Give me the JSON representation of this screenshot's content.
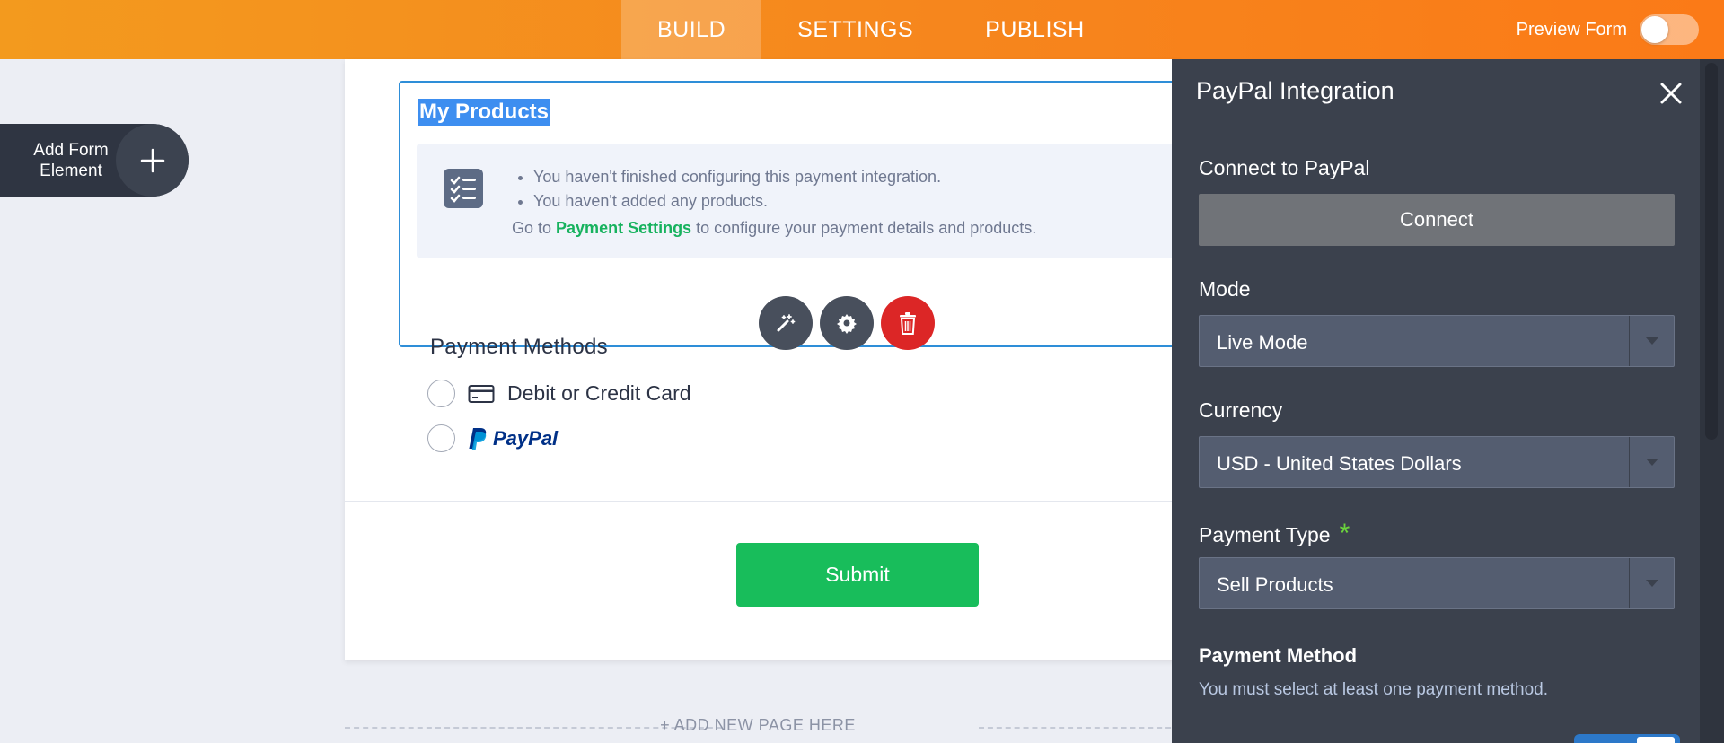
{
  "topbar": {
    "tabs": [
      {
        "label": "BUILD",
        "active": true
      },
      {
        "label": "SETTINGS",
        "active": false
      },
      {
        "label": "PUBLISH",
        "active": false
      }
    ],
    "preview_label": "Preview Form",
    "preview_on": false
  },
  "sidebar": {
    "add_element_line1": "Add Form",
    "add_element_line2": "Element",
    "add_icon": "plus-icon"
  },
  "form": {
    "products_title": "My Products",
    "notice": {
      "items": [
        "You haven't finished configuring this payment integration.",
        "You haven't added any products."
      ],
      "goto_prefix": "Go to ",
      "goto_link": "Payment Settings",
      "goto_suffix": " to configure your payment details and products."
    },
    "tools": [
      "wand-icon",
      "gear-icon",
      "trash-icon"
    ],
    "payment_methods": {
      "title": "Payment Methods",
      "options": [
        {
          "label": "Debit or Credit Card",
          "icon": "credit-card-icon"
        },
        {
          "label": "PayPal",
          "icon": "paypal-logo"
        }
      ]
    },
    "submit_label": "Submit",
    "add_page_label": "+ ADD NEW PAGE HERE"
  },
  "panel": {
    "title": "PayPal Integration",
    "connect_label": "Connect to PayPal",
    "connect_button": "Connect",
    "mode_label": "Mode",
    "mode_value": "Live Mode",
    "currency_label": "Currency",
    "currency_value": "USD - United States Dollars",
    "payment_type_label": "Payment Type",
    "payment_type_required": "*",
    "payment_type_value": "Sell Products",
    "payment_method_heading": "Payment Method",
    "payment_method_help": "You must select at least one payment method."
  },
  "colors": {
    "accent_orange": "#f6861d",
    "panel_bg": "#3b414d",
    "success_green": "#18bd5b",
    "selection_blue": "#2e8ed8",
    "delete_red": "#dc2626",
    "paypal_dark": "#003087",
    "paypal_light": "#009cde"
  }
}
